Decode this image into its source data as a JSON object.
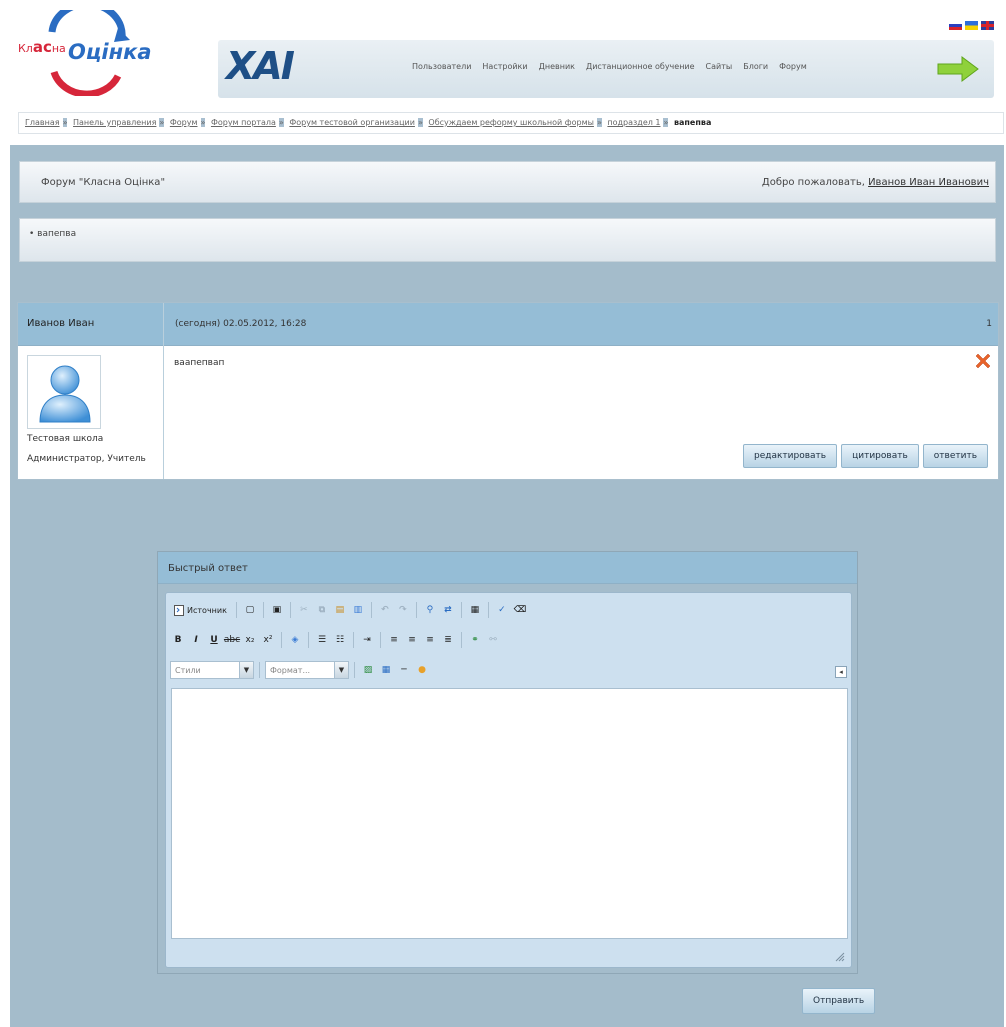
{
  "brand": {
    "logo_prefix": "Кл",
    "logo_middle": "ас",
    "logo_suffix": "на",
    "logo_word": "Оцінка",
    "partner_logo": "ХАІ"
  },
  "languages": [
    "ru-flag",
    "ua-flag",
    "gb-flag"
  ],
  "nav": {
    "items": [
      "Пользователи",
      "Настройки",
      "Дневник",
      "Дистанционное обучение",
      "Сайты",
      "Блоги",
      "Форум"
    ],
    "arrow_icon": "green-arrow-icon"
  },
  "breadcrumb": {
    "items": [
      "Главная",
      "Панель управления",
      "Форум",
      "Форум портала",
      "Форум тестовой организации",
      "Обсуждаем реформу школьной формы",
      "подраздел 1"
    ],
    "separator": "»",
    "current": "вапепва"
  },
  "forum": {
    "title": "Форум \"Класна Оцінка\"",
    "welcome_text": "Добро пожаловать,",
    "welcome_user": "Иванов Иван Иванович",
    "topic": "• вапепва"
  },
  "post": {
    "author": "Иванов Иван",
    "date": "(сегодня) 02.05.2012, 16:28",
    "number": "1",
    "school": "Тестовая школа",
    "roles": "Администратор, Учитель",
    "body": "ваапепвап",
    "buttons": {
      "edit": "редактировать",
      "quote": "цитировать",
      "reply": "ответить"
    }
  },
  "quick_reply": {
    "title": "Быстрый ответ",
    "toolbar": {
      "source": "Источник",
      "styles_placeholder": "Стили",
      "format_placeholder": "Формат..."
    },
    "submit": "Отправить"
  },
  "colors": {
    "panel_bg": "#a4bccb",
    "header_blue": "#95bdd6",
    "editor_bg": "#cde0ef"
  }
}
